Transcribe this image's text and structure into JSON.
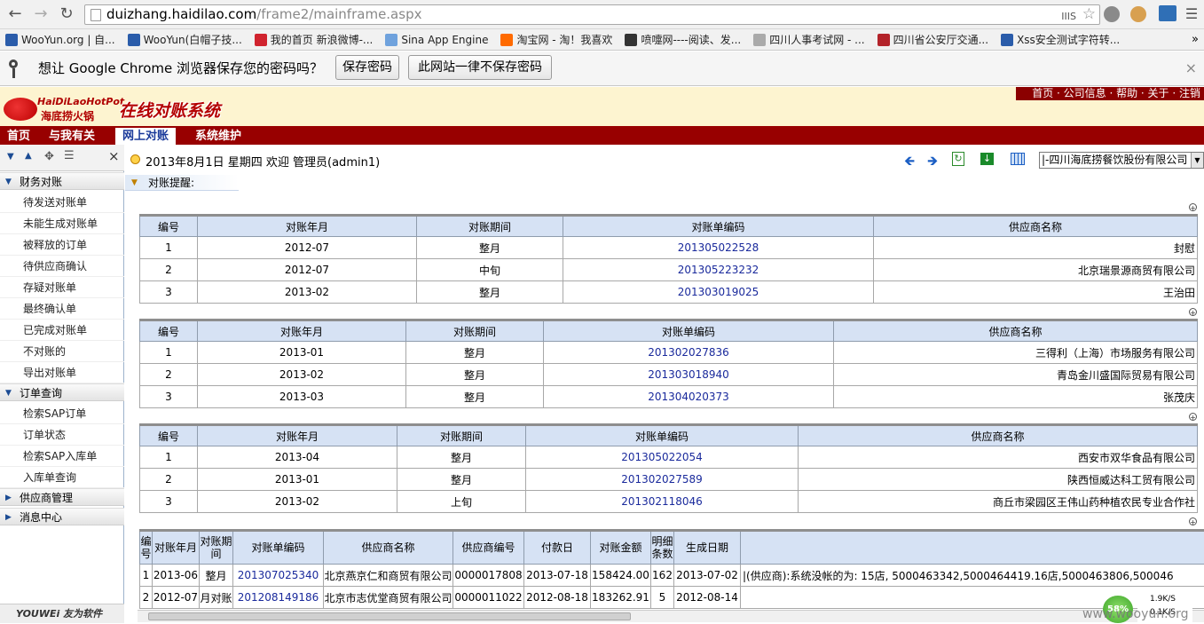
{
  "browser": {
    "url_host": "duizhang.haidilao.com",
    "url_path": "/frame2/mainframe.aspx",
    "bookmarks": [
      {
        "label": "WooYun.org | 自...",
        "color": "#2a5caa"
      },
      {
        "label": "WooYun(白帽子技...",
        "color": "#2a5caa"
      },
      {
        "label": "我的首页 新浪微博-...",
        "color": "#d0232e"
      },
      {
        "label": "Sina App Engine",
        "color": "#6fa2dd"
      },
      {
        "label": "淘宝网 - 淘！我喜欢",
        "color": "#ff6a00"
      },
      {
        "label": "喷嚏网----阅读、发...",
        "color": "#333333"
      },
      {
        "label": "四川人事考试网 - ...",
        "color": "#aaaaaa"
      },
      {
        "label": "四川省公安厅交通...",
        "color": "#b3232a"
      },
      {
        "label": "Xss安全测试字符转...",
        "color": "#2a5caa"
      }
    ],
    "bookmarks_more": "»",
    "infobar_text": "想让 Google Chrome 浏览器保存您的密码吗？",
    "save_password": "保存密码",
    "never_save": "此网站一律不保存密码",
    "close": "×"
  },
  "app": {
    "logo_top": "HaiDiLaoHotPot",
    "logo_bottom": "海底捞火锅",
    "system_title": "在线对账系统",
    "top_links": "首页 · 公司信息 · 帮助 · 关于 · 注销",
    "nav": [
      "首页",
      "与我有关",
      "网上对账",
      "系统维护"
    ],
    "nav_active_index": 2
  },
  "sidebar": {
    "close": "×",
    "sections": [
      {
        "label": "财务对账",
        "expanded": true,
        "items": [
          "待发送对账单",
          "未能生成对账单",
          "被释放的订单",
          "待供应商确认",
          "存疑对账单",
          "最终确认单",
          "已完成对账单",
          "不对账的",
          "导出对账单"
        ]
      },
      {
        "label": "订单查询",
        "expanded": true,
        "items": [
          "检索SAP订单",
          "订单状态",
          "检索SAP入库单",
          "入库单查询"
        ]
      },
      {
        "label": "供应商管理",
        "expanded": false,
        "items": []
      },
      {
        "label": "消息中心",
        "expanded": false,
        "items": []
      }
    ],
    "footer": "YOUWEi 友为软件"
  },
  "content": {
    "welcome": "2013年8月1日 星期四 欢迎 管理员(admin1)",
    "company_select": "|-四川海底捞餐饮股份有限公司",
    "reminder_label": "对账提醒:",
    "small_tables": [
      {
        "headers": [
          "编号",
          "对账年月",
          "对账期间",
          "对账单编码",
          "供应商名称"
        ],
        "rows": [
          [
            "1",
            "2012-07",
            "整月",
            "201305022528",
            "封慰"
          ],
          [
            "2",
            "2012-07",
            "中旬",
            "201305223232",
            "北京瑞景源商贸有限公司"
          ],
          [
            "3",
            "2013-02",
            "整月",
            "201303019025",
            "王治田"
          ]
        ]
      },
      {
        "headers": [
          "编号",
          "对账年月",
          "对账期间",
          "对账单编码",
          "供应商名称"
        ],
        "rows": [
          [
            "1",
            "2013-01",
            "整月",
            "201302027836",
            "三得利（上海）市场服务有限公司"
          ],
          [
            "2",
            "2013-02",
            "整月",
            "201303018940",
            "青岛金川盛国际贸易有限公司"
          ],
          [
            "3",
            "2013-03",
            "整月",
            "201304020373",
            "张茂庆"
          ]
        ]
      },
      {
        "headers": [
          "编号",
          "对账年月",
          "对账期间",
          "对账单编码",
          "供应商名称"
        ],
        "rows": [
          [
            "1",
            "2013-04",
            "整月",
            "201305022054",
            "西安市双华食品有限公司"
          ],
          [
            "2",
            "2013-01",
            "整月",
            "201302027589",
            "陕西恒威达科工贸有限公司"
          ],
          [
            "3",
            "2013-02",
            "上旬",
            "201302118046",
            "商丘市梁园区王伟山药种植农民专业合作社"
          ]
        ]
      }
    ],
    "detail_table": {
      "headers": [
        "编号",
        "对账年月",
        "对账期间",
        "对账单编码",
        "供应商名称",
        "供应商编号",
        "付款日",
        "对账金额",
        "明细条数",
        "生成日期",
        ""
      ],
      "rows": [
        [
          "1",
          "2013-06",
          "整月",
          "201307025340",
          "北京燕京仁和商贸有限公司",
          "0000017808",
          "2013-07-18",
          "158424.00",
          "162",
          "2013-07-02",
          "|(供应商):系统没帐的为: 15店, 5000463342,5000464419.16店,5000463806,500046"
        ],
        [
          "2",
          "2012-07",
          "月对账",
          "201208149186",
          "北京市志优堂商贸有限公司",
          "0000011022",
          "2012-08-18",
          "183262.91",
          "5",
          "2012-08-14",
          ""
        ]
      ]
    }
  },
  "status": {
    "percent": "58%",
    "up_speed": "1.9K/S",
    "down_speed": "0.1K/S",
    "watermark": "www.wooyun.org"
  }
}
